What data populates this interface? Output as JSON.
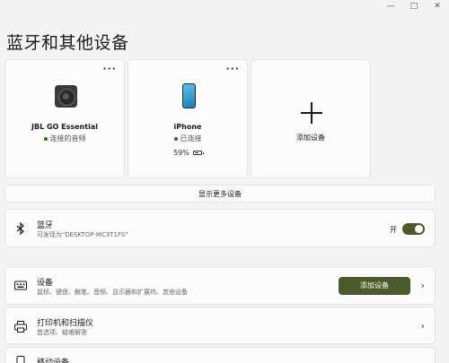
{
  "window": {
    "minimize_glyph": "—",
    "maximize_glyph": "□",
    "close_glyph": "✕"
  },
  "page": {
    "title": "蓝牙和其他设备"
  },
  "devices": [
    {
      "name": "JBL GO Essential",
      "status": "连接的音频",
      "icon": "speaker-icon",
      "more": "···"
    },
    {
      "name": "iPhone",
      "status": "已连接",
      "battery": "59%",
      "icon": "phone-icon",
      "more": "···"
    }
  ],
  "add_card": {
    "label": "添加设备",
    "icon": "plus-icon"
  },
  "show_more": {
    "label": "显示更多设备"
  },
  "bluetooth": {
    "title": "蓝牙",
    "subtitle": "可发现为\"DESKTOP-MC3T1FS\"",
    "toggle_label": "开",
    "enabled": true,
    "icon": "bluetooth-icon"
  },
  "rows": [
    {
      "title": "设备",
      "subtitle": "鼠标、键盘、触笔、音频、显示器和扩展坞、其他设备",
      "button": "添加设备",
      "icon": "keyboard-icon"
    },
    {
      "title": "打印机和扫描仪",
      "subtitle": "首选项、疑难解答",
      "icon": "printer-icon"
    },
    {
      "title": "移动设备",
      "icon": "mobile-icon"
    }
  ],
  "colors": {
    "accent": "#4a5a2a",
    "connected_dot": "#0f7b0f",
    "background": "#f3f3f3",
    "card": "#fbfbfb"
  }
}
